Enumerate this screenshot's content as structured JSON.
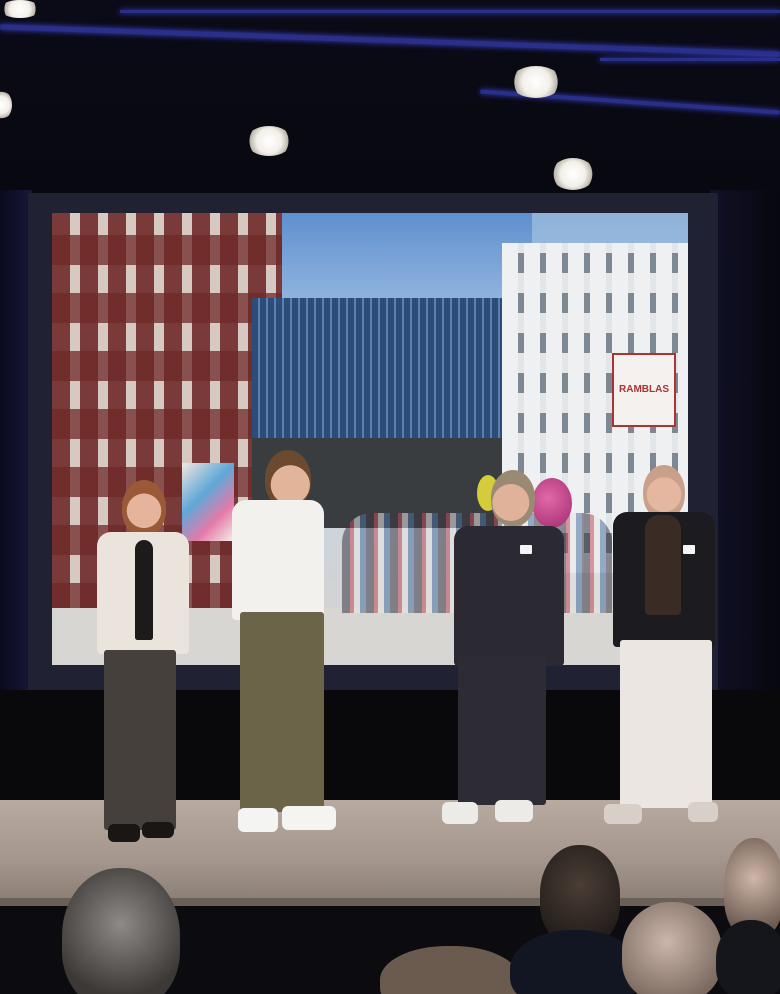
{
  "scene": {
    "description_colors": {
      "truss_light": "#3b44d6",
      "stage_floor": "#b0a298",
      "screen_sky": "#5f8fd0"
    }
  },
  "projection": {
    "sign_text": "RAMBLAS"
  }
}
